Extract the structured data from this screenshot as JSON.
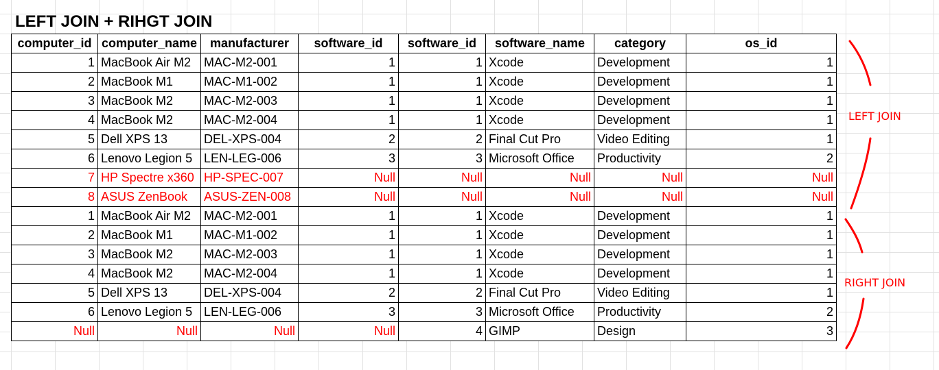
{
  "sheet": {
    "title": "LEFT JOIN + RIHGT JOIN"
  },
  "table": {
    "headers": [
      "computer_id",
      "computer_name",
      "manufacturer",
      "software_id",
      "software_id",
      "software_name",
      "category",
      "os_id"
    ],
    "rows": [
      [
        "1",
        "MacBook Air M2",
        "MAC-M2-001",
        "1",
        "1",
        "Xcode",
        "Development",
        "1"
      ],
      [
        "2",
        "MacBook M1",
        "MAC-M1-002",
        "1",
        "1",
        "Xcode",
        "Development",
        "1"
      ],
      [
        "3",
        "MacBook M2",
        "MAC-M2-003",
        "1",
        "1",
        "Xcode",
        "Development",
        "1"
      ],
      [
        "4",
        "MacBook M2",
        "MAC-M2-004",
        "1",
        "1",
        "Xcode",
        "Development",
        "1"
      ],
      [
        "5",
        "Dell XPS 13",
        "DEL-XPS-004",
        "2",
        "2",
        "Final Cut Pro",
        "Video Editing",
        "1"
      ],
      [
        "6",
        "Lenovo Legion 5",
        "LEN-LEG-006",
        "3",
        "3",
        "Microsoft Office",
        "Productivity",
        "2"
      ],
      [
        "7",
        "HP Spectre x360",
        "HP-SPEC-007",
        "Null",
        "Null",
        "Null",
        "Null",
        "Null"
      ],
      [
        "8",
        "ASUS ZenBook",
        "ASUS-ZEN-008",
        "Null",
        "Null",
        "Null",
        "Null",
        "Null"
      ],
      [
        "1",
        "MacBook Air M2",
        "MAC-M2-001",
        "1",
        "1",
        "Xcode",
        "Development",
        "1"
      ],
      [
        "2",
        "MacBook M1",
        "MAC-M1-002",
        "1",
        "1",
        "Xcode",
        "Development",
        "1"
      ],
      [
        "3",
        "MacBook M2",
        "MAC-M2-003",
        "1",
        "1",
        "Xcode",
        "Development",
        "1"
      ],
      [
        "4",
        "MacBook M2",
        "MAC-M2-004",
        "1",
        "1",
        "Xcode",
        "Development",
        "1"
      ],
      [
        "5",
        "Dell XPS 13",
        "DEL-XPS-004",
        "2",
        "2",
        "Final Cut Pro",
        "Video Editing",
        "1"
      ],
      [
        "6",
        "Lenovo Legion 5",
        "LEN-LEG-006",
        "3",
        "3",
        "Microsoft Office",
        "Productivity",
        "2"
      ],
      [
        "Null",
        "Null",
        "Null",
        "Null",
        "4",
        "GIMP",
        "Design",
        "3"
      ]
    ]
  },
  "annotations": {
    "left_label": "LEFT JOIN",
    "right_label": "RIGHT JOIN",
    "color": "#ff0000"
  }
}
